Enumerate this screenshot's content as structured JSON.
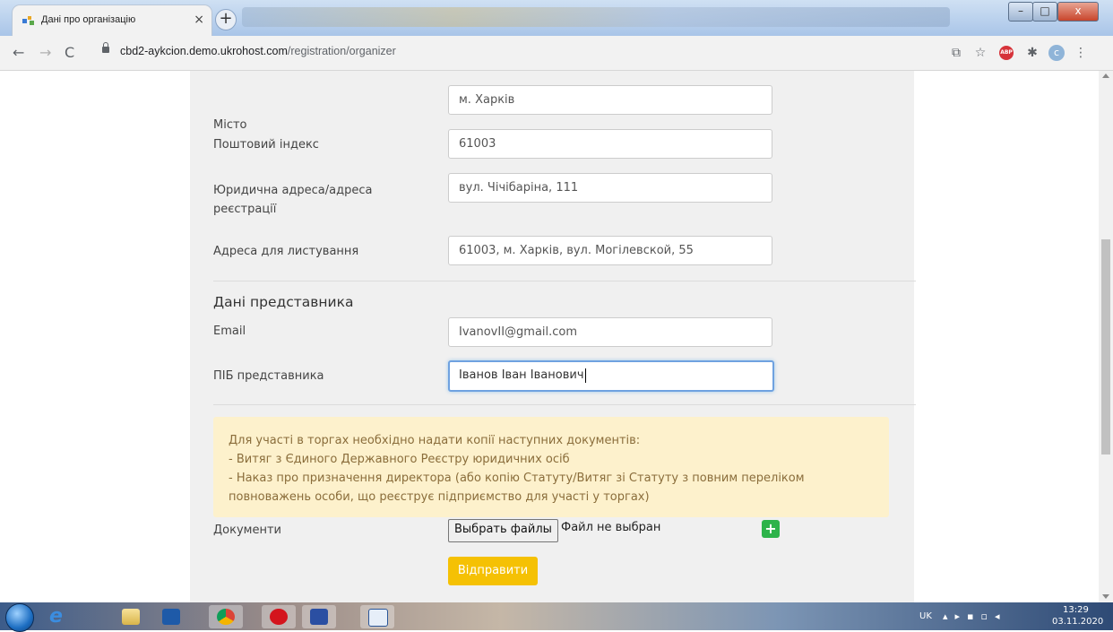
{
  "browser": {
    "tab_title": "Дані про організацію",
    "tab_close": "×",
    "new_tab": "+",
    "url_host": "cbd2-aykcion.demo.ukrohost.com",
    "url_path": "/registration/organizer",
    "window_controls": {
      "minimize": "–",
      "maximize": "□",
      "close": "x"
    }
  },
  "form": {
    "city_label": "Місто",
    "city_value": "м. Харків",
    "postal_label": "Поштовий індекс",
    "postal_value": "61003",
    "legal_address_label_line1": "Юридична адреса/адреса",
    "legal_address_label_line2": "реєстрації",
    "legal_address_value": "вул. Чічібаріна, 111",
    "mail_address_label": "Адреса для листування",
    "mail_address_value": "61003, м. Харків, вул. Могілевской, 55",
    "representative_heading": "Дані представника",
    "email_label": "Email",
    "email_value": "IvanovII@gmail.com",
    "fullname_label": "ПІБ представника",
    "fullname_value": "Іванов Іван Іванович"
  },
  "notice": {
    "line1": "Для участі в торгах необхідно надати копії наступних документів:",
    "line2": "- Витяг з Єдиного Державного Реєстру юридичних осіб",
    "line3": "- Наказ про призначення директора (або копію Статуту/Витяг зі Статуту з повним переліком",
    "line4": "повноважень особи, що реєструє підприємство для участі у торгах)"
  },
  "documents": {
    "label": "Документи",
    "choose_button": "Выбрать файлы",
    "status": "Файл не выбран",
    "add_button": "+"
  },
  "submit_button": "Відправити",
  "taskbar": {
    "language": "UK",
    "time": "13:29",
    "date": "03.11.2020"
  },
  "colors": {
    "accent_yellow": "#f5c104",
    "add_green": "#2db34a",
    "notice_bg": "#fdf1cc",
    "notice_text": "#8a6d3b",
    "panel_bg": "#f0f0f0"
  }
}
